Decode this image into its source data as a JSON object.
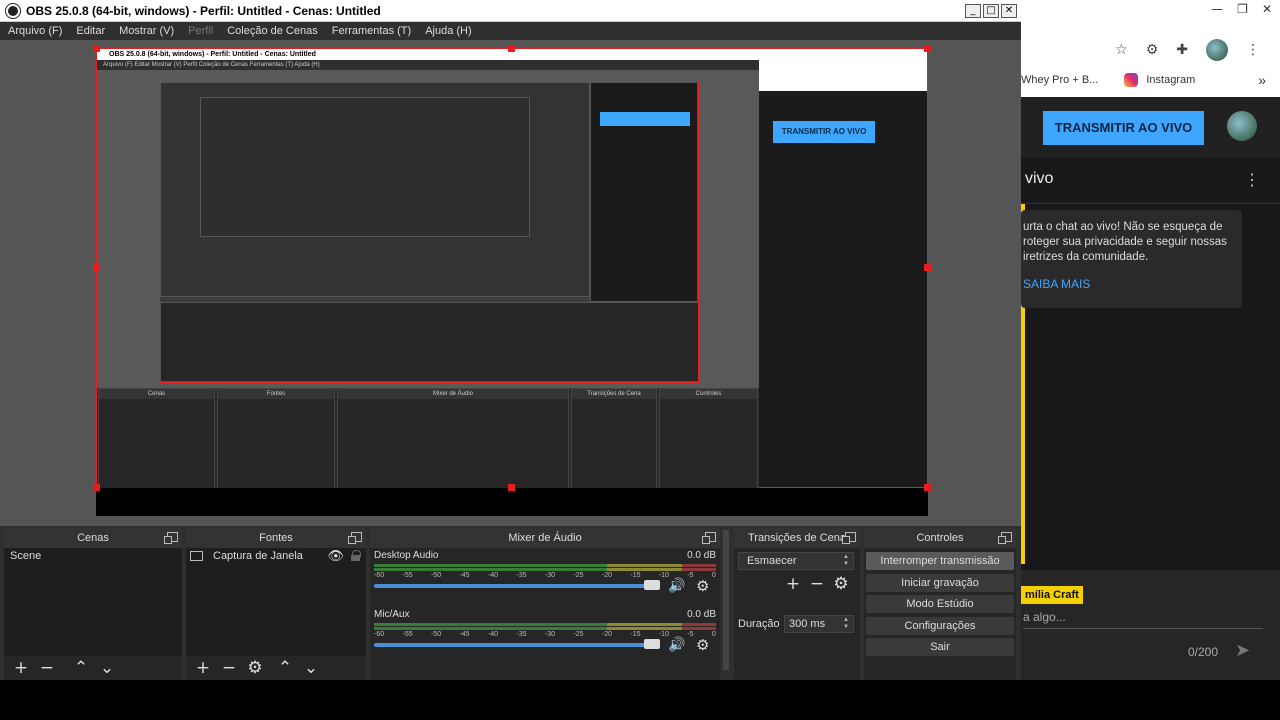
{
  "window": {
    "title": "OBS 25.0.8 (64-bit, windows) - Perfil: Untitled - Cenas: Untitled",
    "min": "_",
    "max": "□",
    "close": "✕"
  },
  "menu": {
    "arquivo": "Arquivo (F)",
    "editar": "Editar",
    "mostrar": "Mostrar (V)",
    "perfil": "Perfil",
    "colecao": "Coleção de Cenas",
    "ferramentas": "Ferramentas (T)",
    "ajuda": "Ajuda (H)"
  },
  "nested": {
    "title": "OBS 25.0.8 (64-bit, windows) - Perfil: Untitled - Cenas: Untitled",
    "menu": "Arquivo (F)   Editar   Mostrar (V)   Perfil   Coleção de Cenas   Ferramentas (T)   Ajuda (H)",
    "docks": [
      "Cenas",
      "Fontes",
      "Mixer de Áudio",
      "Transições de Cena",
      "Controles"
    ],
    "live": "TRANSMITIR AO VIVO"
  },
  "scenes": {
    "title": "Cenas",
    "items": [
      "Scene"
    ]
  },
  "sources": {
    "title": "Fontes",
    "items": [
      "Captura de Janela"
    ]
  },
  "mixer": {
    "title": "Mixer de Áudio",
    "channels": [
      {
        "name": "Desktop Audio",
        "db": "0.0 dB",
        "volume": 0.95
      },
      {
        "name": "Mic/Aux",
        "db": "0.0 dB",
        "volume": 0.95
      }
    ],
    "ticks": [
      "-60",
      "-55",
      "-50",
      "-45",
      "-40",
      "-35",
      "-30",
      "-25",
      "-20",
      "-15",
      "-10",
      "-5",
      "0"
    ]
  },
  "transitions": {
    "title": "Transições de Cena",
    "selected": "Esmaecer",
    "duration_label": "Duração",
    "duration_value": "300 ms"
  },
  "controls": {
    "title": "Controles",
    "buttons": [
      "Interromper transmissão",
      "Iniciar gravação",
      "Modo Estúdio",
      "Configurações",
      "Sair"
    ]
  },
  "chrome": {
    "bookmark_whey": "Whey Pro + B...",
    "bookmark_instagram": "Instagram",
    "more": "»",
    "live_button": "TRANSMITIR AO VIVO",
    "chat_title": "vivo",
    "chat_notice": "urta o chat ao vivo! Não se esqueça de\nroteger sua privacidade e seguir nossas\niretrizes da comunidade.",
    "learn_more": "SAIBA MAIS",
    "channel_name": "mília Craft",
    "input_placeholder": "a algo...",
    "counter": "0/200"
  }
}
